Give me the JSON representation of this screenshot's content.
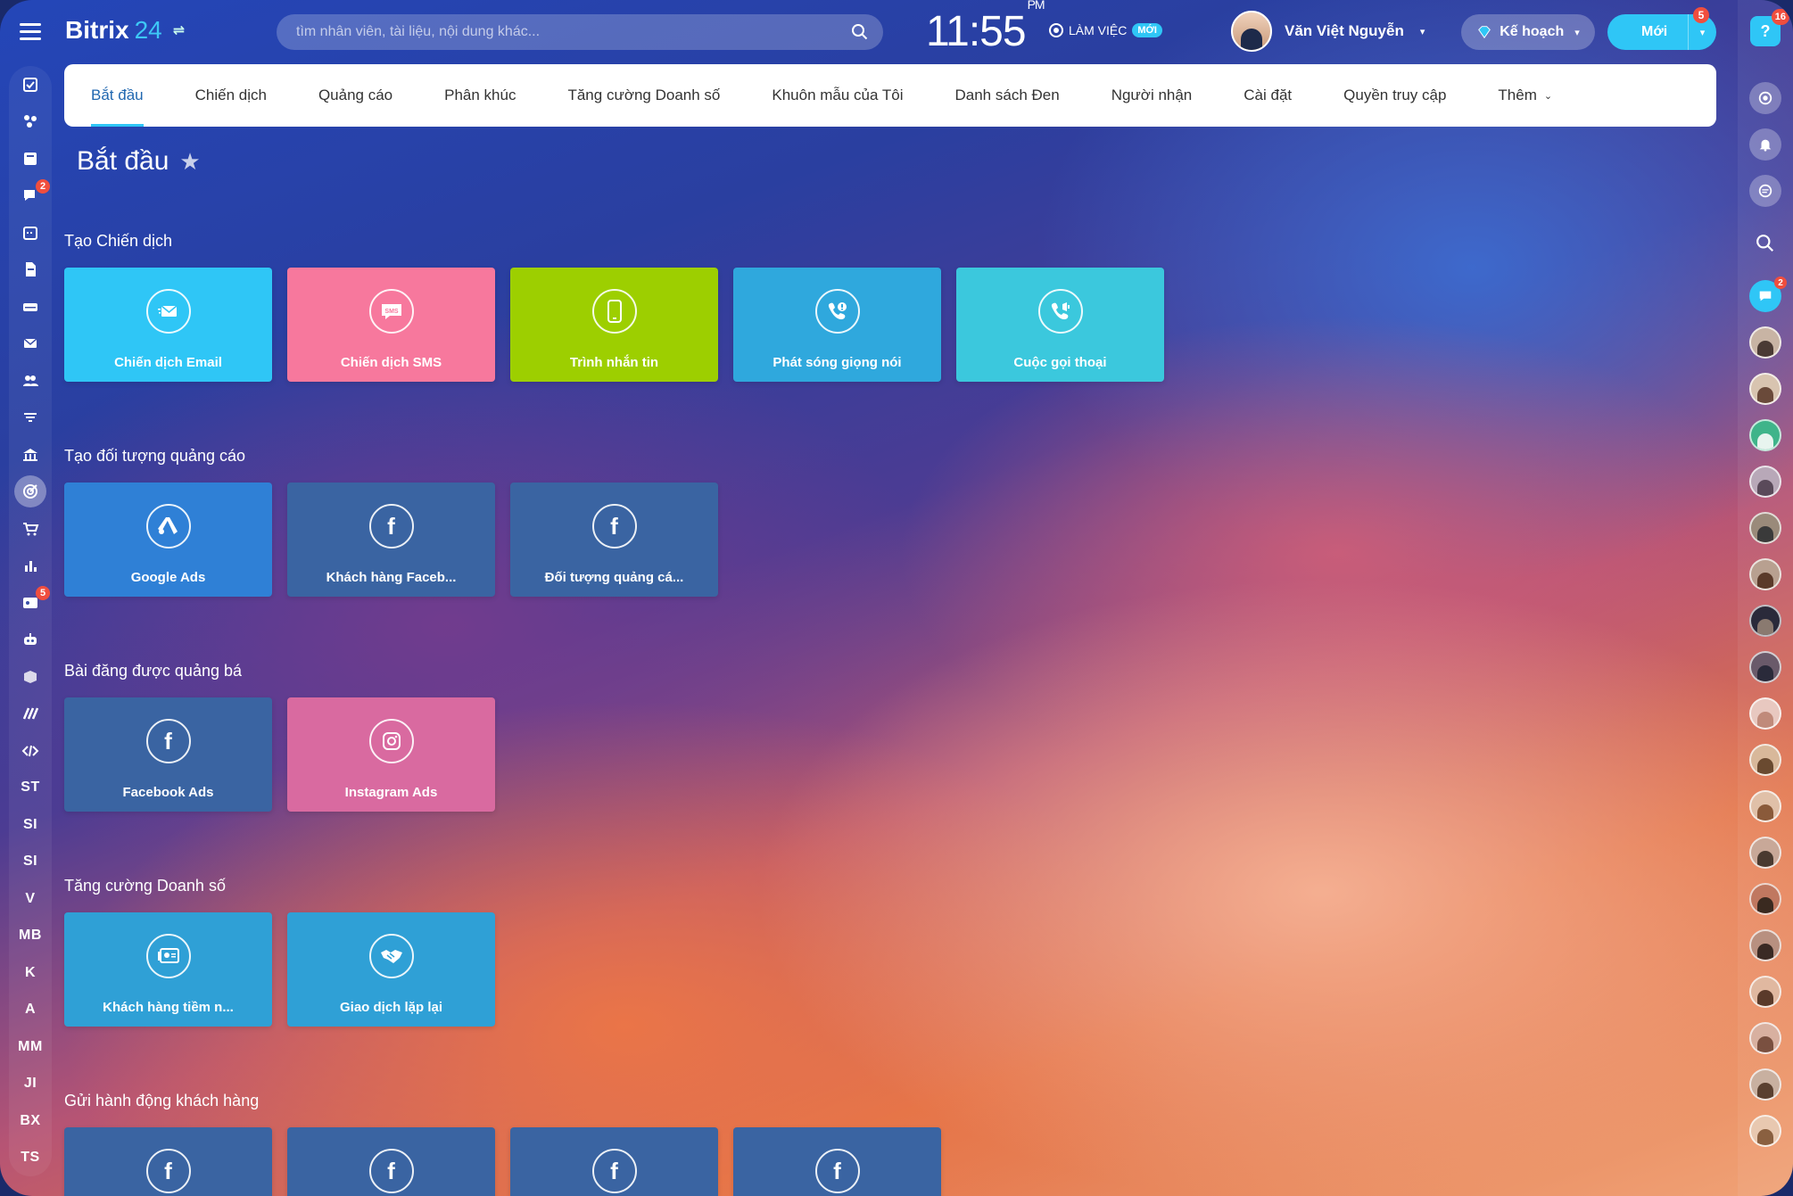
{
  "app": {
    "brand": "Bitrix",
    "brand_num": "24"
  },
  "search": {
    "placeholder": "tìm nhân viên, tài liệu, nội dung khác..."
  },
  "clock": {
    "time": "11:55",
    "ampm": "PM"
  },
  "work": {
    "status": "LÀM VIỆC",
    "badge": "MỚI"
  },
  "user": {
    "name": "Văn Việt Nguyễn"
  },
  "plan": {
    "label": "Kế hoạch"
  },
  "new_btn": {
    "label": "Mới",
    "badge": "5"
  },
  "right_bar": {
    "help_badge": "16",
    "chat_badge": "2"
  },
  "left_nav": {
    "chat_badge": "2",
    "contact_badge": "5",
    "text_items": [
      "ST",
      "SI",
      "SI",
      "V",
      "MB",
      "K",
      "A",
      "MM",
      "JI",
      "BX",
      "TS"
    ]
  },
  "tabs": [
    {
      "label": "Bắt đầu"
    },
    {
      "label": "Chiến dịch"
    },
    {
      "label": "Quảng cáo"
    },
    {
      "label": "Phân khúc"
    },
    {
      "label": "Tăng cường Doanh số"
    },
    {
      "label": "Khuôn mẫu của Tôi"
    },
    {
      "label": "Danh sách Đen"
    },
    {
      "label": "Người nhận"
    },
    {
      "label": "Cài đặt"
    },
    {
      "label": "Quyền truy cập"
    },
    {
      "label": "Thêm"
    }
  ],
  "page": {
    "title": "Bắt đầu"
  },
  "sections": [
    {
      "title": "Tạo Chiến dịch",
      "tiles": [
        {
          "label": "Chiến dịch Email",
          "icon": "envelope-icon",
          "color": "#2fc6f6"
        },
        {
          "label": "Chiến dịch SMS",
          "icon": "sms-icon",
          "color": "#f7789d"
        },
        {
          "label": "Trình nhắn tin",
          "icon": "phone-device-icon",
          "color": "#9dcf00"
        },
        {
          "label": "Phát sóng giọng nói",
          "icon": "voice-call-icon",
          "color": "#2fa8dd"
        },
        {
          "label": "Cuộc gọi thoại",
          "icon": "phone-call-icon",
          "color": "#3bc8dd"
        }
      ]
    },
    {
      "title": "Tạo đối tượng quảng cáo",
      "tiles": [
        {
          "label": "Google Ads",
          "icon": "google-ads-icon",
          "color": "#2f80d6"
        },
        {
          "label": "Khách hàng Faceb...",
          "icon": "facebook-icon",
          "color": "#3a64a2"
        },
        {
          "label": "Đối tượng quảng cá...",
          "icon": "facebook-icon",
          "color": "#3a64a2"
        }
      ]
    },
    {
      "title": "Bài đăng được quảng bá",
      "tiles": [
        {
          "label": "Facebook Ads",
          "icon": "facebook-icon",
          "color": "#3a64a2"
        },
        {
          "label": "Instagram Ads",
          "icon": "instagram-icon",
          "color": "#d96aa0"
        }
      ]
    },
    {
      "title": "Tăng cường Doanh số",
      "tiles": [
        {
          "label": "Khách hàng tiềm n...",
          "icon": "lead-card-icon",
          "color": "#2fa0d6"
        },
        {
          "label": "Giao dịch lặp lại",
          "icon": "handshake-icon",
          "color": "#2fa0d6"
        }
      ]
    },
    {
      "title": "Gửi hành động khách hàng",
      "tiles": [
        {
          "label": "",
          "icon": "facebook-icon",
          "color": "#3a64a2"
        },
        {
          "label": "",
          "icon": "facebook-icon",
          "color": "#3a64a2"
        },
        {
          "label": "",
          "icon": "facebook-icon",
          "color": "#3a64a2"
        },
        {
          "label": "",
          "icon": "facebook-icon",
          "color": "#3a64a2"
        }
      ]
    }
  ]
}
